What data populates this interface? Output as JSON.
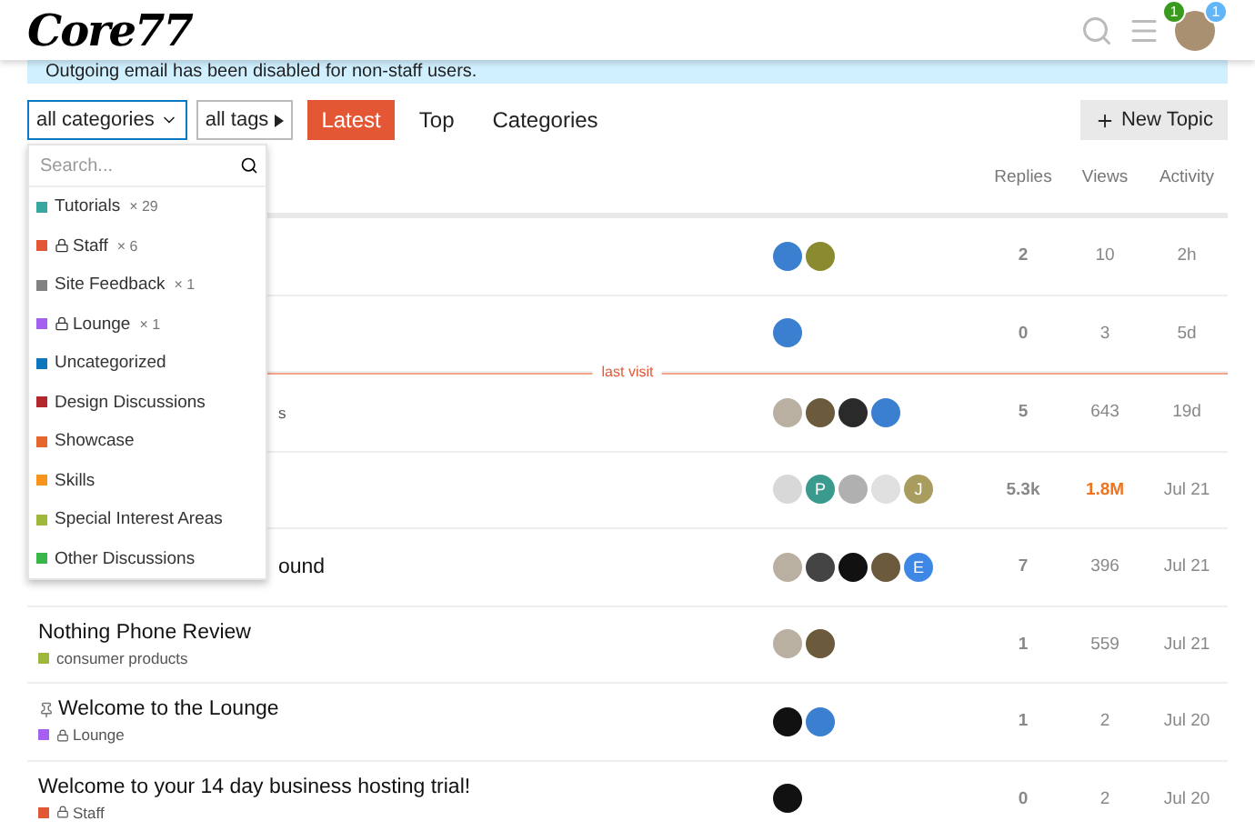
{
  "header": {
    "logo": "Core77",
    "notifications": [
      {
        "count": "1",
        "color": "#3a9a1e"
      },
      {
        "count": "1",
        "color": "#64b5f6"
      }
    ]
  },
  "banner": "Outgoing email has been disabled for non-staff users.",
  "nav": {
    "category_filter": "all categories",
    "tag_filter": "all tags",
    "tabs": [
      {
        "label": "Latest",
        "selected": true
      },
      {
        "label": "Top",
        "selected": false
      },
      {
        "label": "Categories",
        "selected": false
      }
    ],
    "new_topic": "New Topic"
  },
  "dropdown": {
    "placeholder": "Search...",
    "items": [
      {
        "name": "Tutorials",
        "color": "#3aa6a0",
        "locked": false,
        "count": "× 29"
      },
      {
        "name": "Staff",
        "color": "#e45735",
        "locked": true,
        "count": "× 6"
      },
      {
        "name": "Site Feedback",
        "color": "#808281",
        "locked": false,
        "count": "× 1"
      },
      {
        "name": "Lounge",
        "color": "#a461ef",
        "locked": true,
        "count": "× 1"
      },
      {
        "name": "Uncategorized",
        "color": "#0e76bd",
        "locked": false
      },
      {
        "name": "Design Discussions",
        "color": "#b3282d",
        "locked": false
      },
      {
        "name": "Showcase",
        "color": "#e6672e",
        "locked": false
      },
      {
        "name": "Skills",
        "color": "#f7941d",
        "locked": false
      },
      {
        "name": "Special Interest Areas",
        "color": "#9eb83b",
        "locked": false
      },
      {
        "name": "Other Discussions",
        "color": "#3ab54a",
        "locked": false
      }
    ]
  },
  "table": {
    "columns": [
      "Replies",
      "Views",
      "Activity"
    ],
    "rows": [
      {
        "kind": "topic",
        "posters": [
          {
            "color": "#3b7fd0"
          },
          {
            "color": "#8a8a30"
          }
        ],
        "replies": "2",
        "views": "10",
        "hot": false,
        "activity": "2h"
      },
      {
        "kind": "topic",
        "posters": [
          {
            "color": "#3b7fd0"
          }
        ],
        "replies": "0",
        "views": "3",
        "hot": false,
        "activity": "5d"
      },
      {
        "kind": "divider",
        "label": "last visit"
      },
      {
        "kind": "topic",
        "category_fragment": "s",
        "posters": [
          {
            "color": "#b9b0a2"
          },
          {
            "color": "#6b5a3c"
          },
          {
            "color": "#2a2a2a"
          },
          {
            "color": "#3b7fd0"
          }
        ],
        "replies": "5",
        "views": "643",
        "hot": false,
        "activity": "19d"
      },
      {
        "kind": "topic",
        "posters": [
          {
            "color": "#d8d8d8"
          },
          {
            "letter": "P",
            "color": "#3a9a8e"
          },
          {
            "color": "#b0b0b0"
          },
          {
            "color": "#e0e0e0"
          },
          {
            "letter": "J",
            "color": "#a89c5e"
          }
        ],
        "replies": "5.3k",
        "views": "1.8M",
        "hot": true,
        "activity": "Jul 21"
      },
      {
        "kind": "topic",
        "title": "ound",
        "posters": [
          {
            "color": "#b9b0a2"
          },
          {
            "color": "#444444"
          },
          {
            "color": "#111111"
          },
          {
            "color": "#6b5a3c"
          },
          {
            "letter": "E",
            "color": "#3f87e4"
          }
        ],
        "replies": "7",
        "views": "396",
        "hot": false,
        "activity": "Jul 21"
      },
      {
        "kind": "topic",
        "title": "Nothing Phone Review",
        "pinned": false,
        "category": {
          "name": "consumer products",
          "color": "#9eb83b",
          "locked": false
        },
        "posters": [
          {
            "color": "#b9b0a2"
          },
          {
            "color": "#6b5a3c"
          }
        ],
        "replies": "1",
        "views": "559",
        "hot": false,
        "activity": "Jul 21"
      },
      {
        "kind": "topic",
        "title": "Welcome to the Lounge",
        "pinned": true,
        "category": {
          "name": "Lounge",
          "color": "#a461ef",
          "locked": true
        },
        "posters": [
          {
            "color": "#111111"
          },
          {
            "color": "#3b7fd0"
          }
        ],
        "replies": "1",
        "views": "2",
        "hot": false,
        "activity": "Jul 20"
      },
      {
        "kind": "topic",
        "title": "Welcome to your 14 day business hosting trial!",
        "pinned": false,
        "category": {
          "name": "Staff",
          "color": "#e45735",
          "locked": true
        },
        "posters": [
          {
            "color": "#111111"
          }
        ],
        "replies": "0",
        "views": "2",
        "hot": false,
        "activity": "Jul 20"
      }
    ]
  }
}
